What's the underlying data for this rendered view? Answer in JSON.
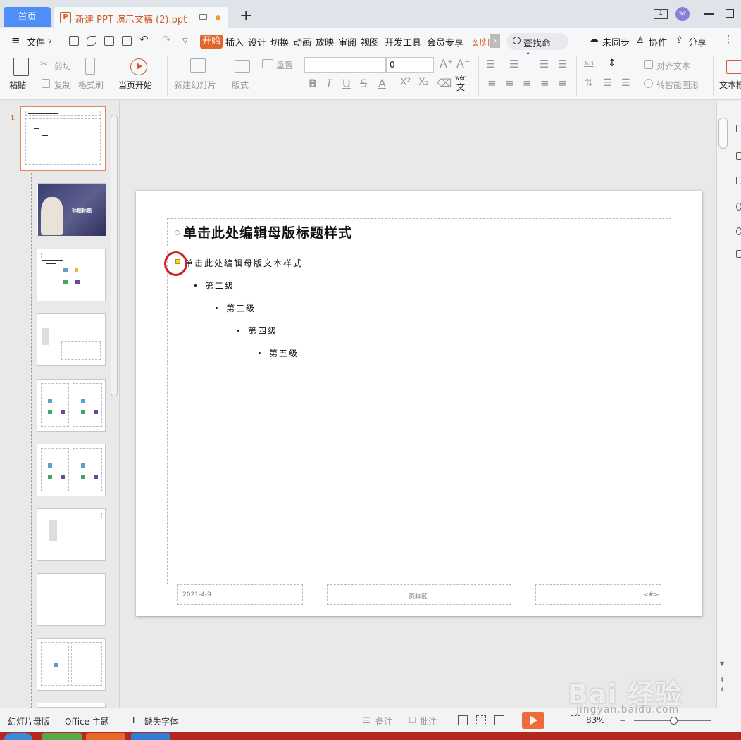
{
  "titlebar": {
    "home_tab": "首页",
    "doc_tab_title": "新建 PPT 演示文稿 (2).ppt",
    "doc_icon_glyph": "P",
    "new_tab": "+",
    "window_count": "1",
    "avatar_text": "WP"
  },
  "menu": {
    "file": "文件",
    "tabs": [
      "开始",
      "插入",
      "设计",
      "切换",
      "动画",
      "放映",
      "审阅",
      "视图",
      "开发工具",
      "会员专享",
      "幻灯"
    ],
    "more": "›",
    "search": "查找命令...",
    "sync": "未同步",
    "collab": "协作",
    "share": "分享",
    "overflow": "⋮"
  },
  "ribbon": {
    "paste": "粘贴",
    "cut": "剪切",
    "copy": "复制",
    "format_painter": "格式刷",
    "from_current": "当页开始",
    "new_slide": "新建幻灯片",
    "layout": "版式",
    "reset": "重置",
    "font_size": "0",
    "align_text": "对齐文本",
    "smartart": "转智能图形",
    "textbox": "文本框",
    "bold": "B",
    "italic": "I",
    "underline": "U",
    "strike": "S",
    "font_color": "A",
    "superscript": "X²",
    "subscript": "X₂",
    "wen": "wén",
    "wen_char": "文",
    "grow_font": "A⁺",
    "shrink_font": "A⁻",
    "ab_label": "AB"
  },
  "thumbnails": {
    "first_number": "1",
    "cover_title": "标题标题"
  },
  "slide": {
    "title": "单击此处编辑母版标题样式",
    "level1": "单击此处编辑母版文本样式",
    "level2": "第二级",
    "level3": "第三级",
    "level4": "第四级",
    "level5": "第五级",
    "footer_date": "2021-4-9",
    "footer_center": "页脚区",
    "footer_number": "<#>"
  },
  "statusbar": {
    "master_view": "幻灯片母版",
    "theme": "Office 主题",
    "missing_font": "缺失字体",
    "notes": "备注",
    "comments": "批注",
    "zoom": "83%"
  },
  "watermark": {
    "logo": "Bai 经验",
    "url": "jingyan.baidu.com"
  },
  "colors": {
    "accent": "#e0642b",
    "home_tab": "#4f8ef7",
    "selection_ring": "#d31d2a",
    "bullet_fill": "#f6d51a"
  }
}
